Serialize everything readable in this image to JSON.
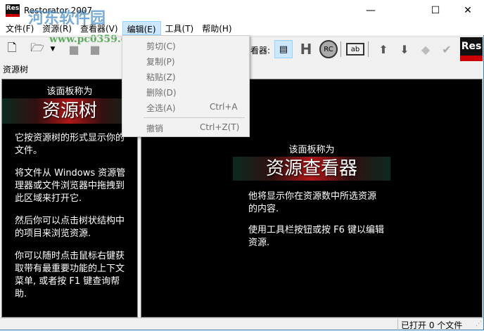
{
  "window": {
    "title": "Restorator 2007",
    "app_icon": "Res"
  },
  "watermark": {
    "text": "河东软件园",
    "url": "www.pc0359.cn"
  },
  "menubar": [
    "文件(F)",
    "资源(R)",
    "查看器(V)",
    "编辑(E)",
    "工具(T)",
    "帮助(H)"
  ],
  "edit_menu": [
    {
      "label": "剪切(C)",
      "shortcut": ""
    },
    {
      "label": "复制(P)",
      "shortcut": ""
    },
    {
      "label": "粘贴(Z)",
      "shortcut": ""
    },
    {
      "label": "删除(D)",
      "shortcut": ""
    },
    {
      "label": "全选(A)",
      "shortcut": "Ctrl+A"
    },
    {
      "label": "撤销",
      "shortcut": "Ctrl+Z(T)"
    }
  ],
  "toolbar": {
    "viewer_label": "看器:",
    "res_logo": "Res"
  },
  "tree_panel": {
    "header": "资源树",
    "intro": "该面板称为",
    "name": "资源树",
    "paragraphs": [
      "它按资源树的形式显示你的文件。",
      "将文件从 Windows 资源管理器或文件浏览器中拖拽到此区域来打开它.",
      "然后你可以点击树状结构中的项目来浏览资源.",
      "你可以随时点击鼠标右键获取带有最重要功能的上下文菜单, 或者按 F1 键查询帮助."
    ]
  },
  "viewer_panel": {
    "intro": "该面板称为",
    "name": "资源查看器",
    "paragraphs": [
      "他将显示你在资源数中所选资源的内容.",
      "使用工具栏按钮或按 F6 键以编辑资源."
    ]
  },
  "status": "已打开 0 个文件"
}
